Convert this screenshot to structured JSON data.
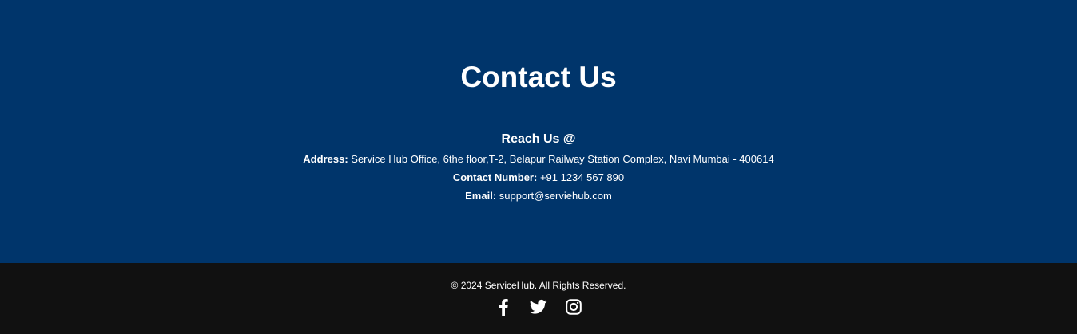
{
  "contact": {
    "title": "Contact Us",
    "reach_heading": "Reach Us @",
    "address_label": "Address:",
    "address_value": "Service Hub Office, 6the floor,T-2, Belapur Railway Station Complex, Navi Mumbai - 400614",
    "phone_label": "Contact Number:",
    "phone_value": "+91 1234 567 890",
    "email_label": "Email:",
    "email_value": "support@serviehub.com"
  },
  "footer": {
    "copyright": "© 2024 ServiceHub. All Rights Reserved.",
    "social": [
      {
        "icon": "facebook-icon"
      },
      {
        "icon": "twitter-icon"
      },
      {
        "icon": "instagram-icon"
      }
    ]
  },
  "colors": {
    "contact_background": "#00356b",
    "footer_background": "#111111",
    "text": "#ffffff"
  }
}
